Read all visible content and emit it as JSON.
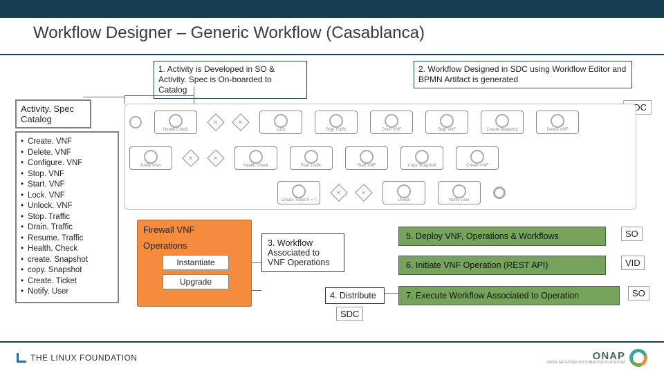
{
  "title": "Workflow Designer – Generic Workflow (Casablanca)",
  "step1": "1. Activity is Developed in SO & Activity. Spec is On-boarded to Catalog",
  "step2": "2. Workflow Designed in SDC using Workflow Editor and BPMN Artifact is generated",
  "catalog_title": "Activity. Spec Catalog",
  "catalog": [
    "Create. VNF",
    "Delete. VNF",
    "Configure. VNF",
    "Stop. VNF",
    "Start. VNF",
    "Lock. VNF",
    "Unlock. VNF",
    "Stop. Traffic",
    "Drain. Traffic",
    "Resume. Traffic",
    "Health. Check",
    "create. Snapshot",
    "copy. Snapshot",
    "Create. Ticket",
    "Notify. User"
  ],
  "sdc_label": "SDC",
  "bpmn_r1": [
    "Health Check",
    "",
    "",
    "Lock",
    "Stop Traffic",
    "Drain VNF",
    "Stop VNF",
    "Create Snapshot",
    "Delete VNF"
  ],
  "bpmn_r2": [
    "Notify User",
    "",
    "",
    "Health Check",
    "Start Traffic",
    "Start VNF",
    "Copy Snapshot",
    "Create VNF"
  ],
  "bpmn_r3": [
    "Create Ticket 0 = ?",
    "",
    "",
    "Unlock",
    "Notify User"
  ],
  "vnf": {
    "title": "Firewall VNF",
    "ops_label": "Operations",
    "op1": "Instantiate",
    "op2": "Upgrade"
  },
  "step3": "3. Workflow Associated to VNF Operations",
  "step4": "4. Distribute",
  "sdc_tag": "SDC",
  "step5": "5. Deploy VNF, Operations & Workflows",
  "step6": "6. Initiate VNF Operation (REST API)",
  "step7": "7. Execute Workflow Associated to Operation",
  "so_label": "SO",
  "vid_label": "VID",
  "so_label2": "SO",
  "footer": {
    "lf": "THE LINUX FOUNDATION",
    "onap": "ONAP",
    "onap_sub": "OPEN NETWORK AUTOMATION PLATFORM"
  }
}
